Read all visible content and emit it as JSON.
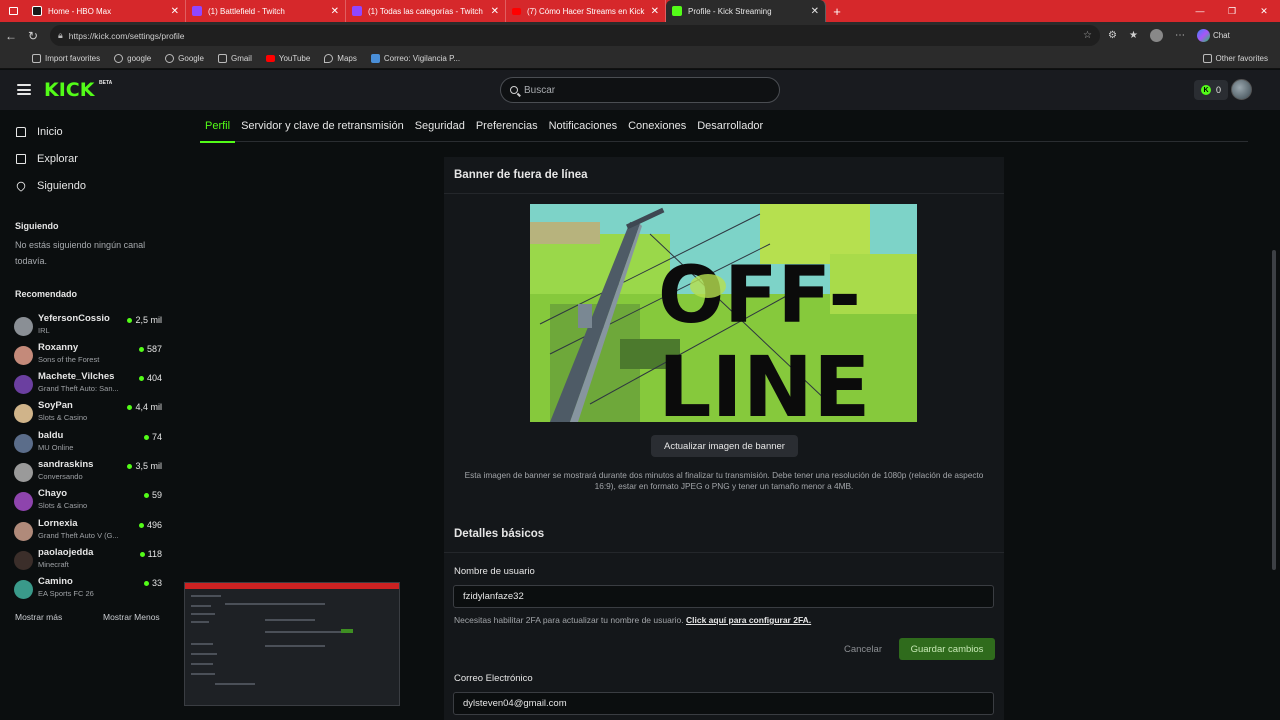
{
  "browser": {
    "tabs": [
      {
        "label": "Home - HBO Max",
        "color": "#7b2ff7",
        "active": false
      },
      {
        "label": "(1) Battlefield - Twitch",
        "color": "#9146ff",
        "active": false
      },
      {
        "label": "(1) Todas las categorías - Twitch",
        "color": "#9146ff",
        "active": false
      },
      {
        "label": "(7) Cómo Hacer Streams en Kick",
        "color": "#ff0000",
        "active": false
      },
      {
        "label": "Profile - Kick Streaming",
        "color": "#53fc18",
        "active": true
      }
    ],
    "url": "https://kick.com/settings/profile",
    "chat_label": "Chat",
    "bookmarks": [
      {
        "label": "Import favorites",
        "color": "#bbbbbb"
      },
      {
        "label": "google",
        "color": "#bbbbbb"
      },
      {
        "label": "Google",
        "color": "#bbbbbb"
      },
      {
        "label": "Gmail",
        "color": "#bbbbbb"
      },
      {
        "label": "YouTube",
        "color": "#ff0000"
      },
      {
        "label": "Maps",
        "color": "#bbbbbb"
      },
      {
        "label": "Correo: Vigilancia P...",
        "color": "#4a8fd8"
      }
    ],
    "other_favorites": "Other favorites"
  },
  "header": {
    "logo": "KICK",
    "logo_badge": "BETA",
    "search_placeholder": "Buscar",
    "kicks_count": "0"
  },
  "sidebar": {
    "nav": [
      {
        "label": "Inicio",
        "icon": "home-icon"
      },
      {
        "label": "Explorar",
        "icon": "compass-icon"
      },
      {
        "label": "Siguiendo",
        "icon": "heart-icon"
      }
    ],
    "following_title": "Siguiendo",
    "following_empty": "No estás siguiendo ningún canal todavía.",
    "recommended_title": "Recomendado",
    "channels": [
      {
        "name": "YefersonCossio",
        "category": "IRL",
        "viewers": "2,5 mil",
        "avatar": "#8a8f95"
      },
      {
        "name": "Roxanny",
        "category": "Sons of the Forest",
        "viewers": "587",
        "avatar": "#c48a7a"
      },
      {
        "name": "Machete_Vilches",
        "category": "Grand Theft Auto: San...",
        "viewers": "404",
        "avatar": "#6b3fa0"
      },
      {
        "name": "SoyPan",
        "category": "Slots & Casino",
        "viewers": "4,4 mil",
        "avatar": "#d0b48a"
      },
      {
        "name": "baldu",
        "category": "MU Online",
        "viewers": "74",
        "avatar": "#5b6d8a"
      },
      {
        "name": "sandraskins",
        "category": "Conversando",
        "viewers": "3,5 mil",
        "avatar": "#9a9a9a"
      },
      {
        "name": "Chayo",
        "category": "Slots & Casino",
        "viewers": "59",
        "avatar": "#8e44ad"
      },
      {
        "name": "Lornexia",
        "category": "Grand Theft Auto V (G...",
        "viewers": "496",
        "avatar": "#b08a7a"
      },
      {
        "name": "paolaojedda",
        "category": "Minecraft",
        "viewers": "118",
        "avatar": "#3b2e2a"
      },
      {
        "name": "Camino",
        "category": "EA Sports FC 26",
        "viewers": "33",
        "avatar": "#3a9a8a"
      }
    ],
    "show_more": "Mostrar más",
    "show_less": "Mostrar Menos"
  },
  "settings": {
    "tabs": [
      "Perfil",
      "Servidor y clave de retransmisión",
      "Seguridad",
      "Preferencias",
      "Notificaciones",
      "Conexiones",
      "Desarrollador"
    ],
    "active_tab": "Perfil"
  },
  "banner_section": {
    "title": "Banner de fuera de línea",
    "banner_text_1": "OFF-",
    "banner_text_2": "LINE",
    "update_button": "Actualizar imagen de banner",
    "note": "Esta imagen de banner se mostrará durante dos minutos al finalizar tu transmisión. Debe tener una resolución de 1080p (relación de aspecto 16:9), estar en formato JPEG o PNG y tener un tamaño menor a 4MB."
  },
  "basic_section": {
    "title": "Detalles básicos",
    "username_label": "Nombre de usuario",
    "username_value": "fzidylanfaze32",
    "help_text": "Necesitas habilitar 2FA para actualizar tu nombre de usuario.",
    "help_link": "Click aquí para configurar 2FA.",
    "cancel": "Cancelar",
    "save": "Guardar cambios",
    "email_label": "Correo Electrónico",
    "email_value": "dylsteven04@gmail.com"
  },
  "colors": {
    "kick_green": "#53fc18",
    "tab_bar": "#d6282b"
  }
}
